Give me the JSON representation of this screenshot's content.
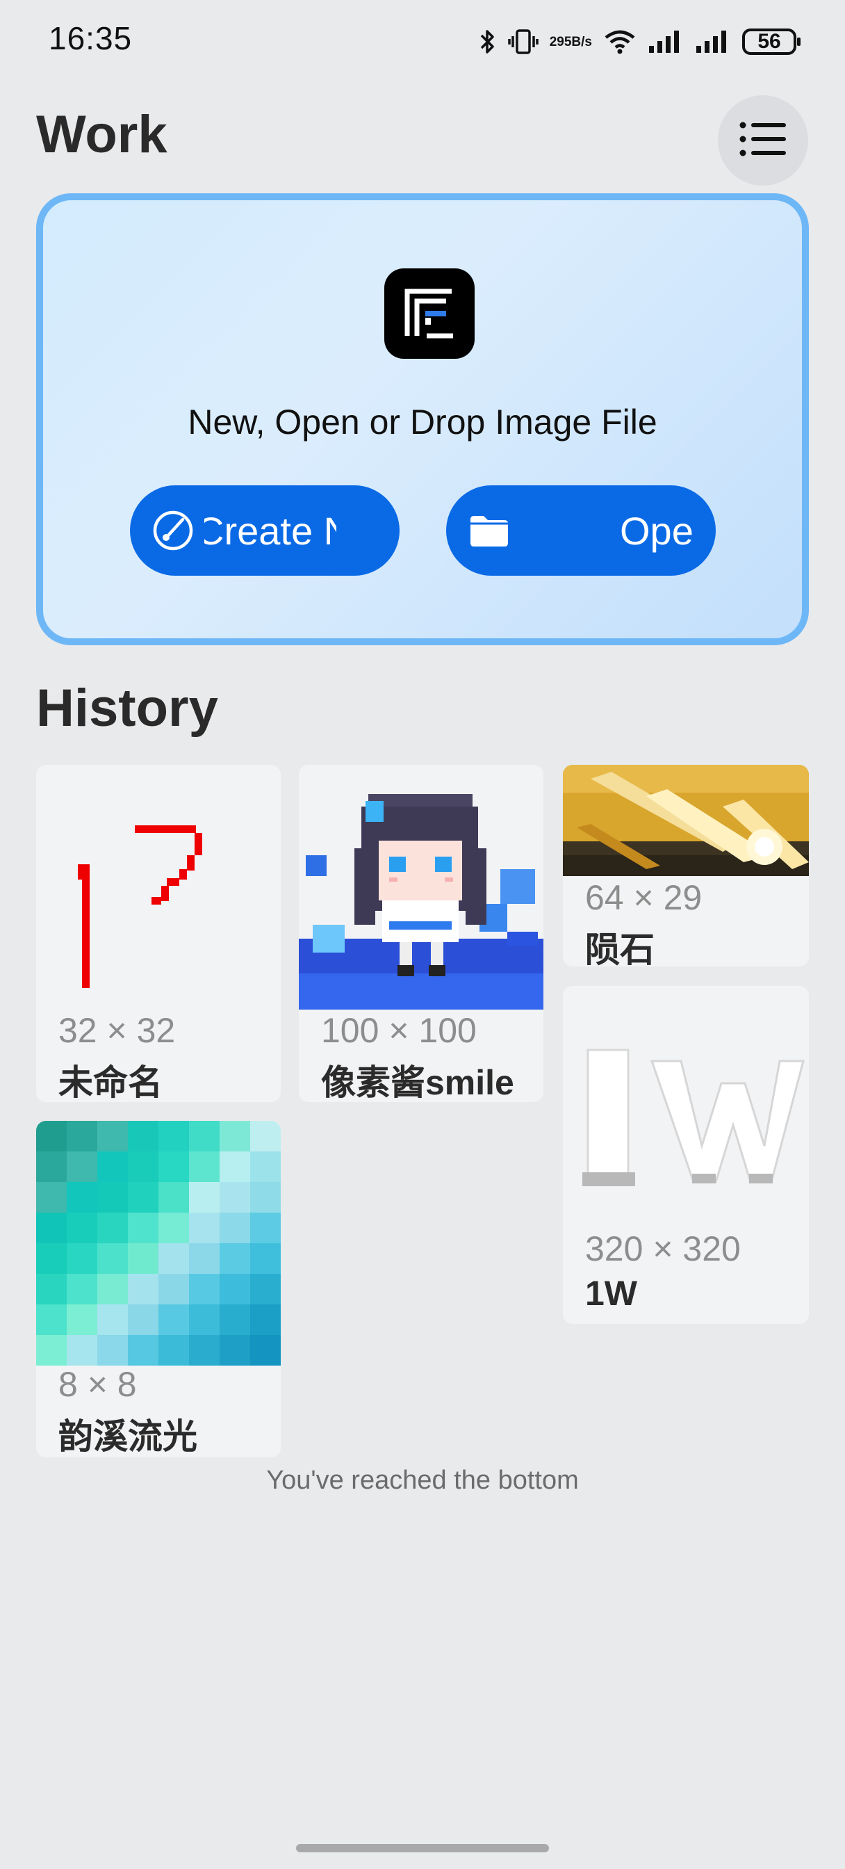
{
  "status_bar": {
    "time": "16:35",
    "net_speed_value": "295",
    "net_speed_unit": "B/s",
    "battery": "56",
    "icons": [
      "bluetooth-icon",
      "vibrate-icon",
      "wifi-icon",
      "signal-icon",
      "signal-icon",
      "battery-icon"
    ]
  },
  "header": {
    "title": "Work",
    "menu_icon": "list-menu-icon"
  },
  "drop_card": {
    "prompt": "New, Open or Drop Image File",
    "create_label": "Create New",
    "open_label": "Open",
    "colors": {
      "border": "#6db7f6",
      "button": "#0a6ae6"
    }
  },
  "history": {
    "title": "History",
    "items": [
      {
        "dims": "32 × 32",
        "name": "未命名"
      },
      {
        "dims": "100 × 100",
        "name": "像素酱smile"
      },
      {
        "dims": "64 × 29",
        "name": "陨石"
      },
      {
        "dims": "320 × 320",
        "name": "1W"
      },
      {
        "dims": "8 × 8",
        "name": "韵溪流光"
      }
    ],
    "footer": "You've reached the bottom"
  }
}
